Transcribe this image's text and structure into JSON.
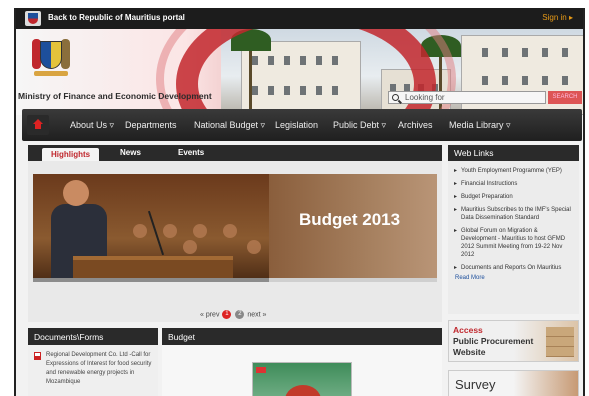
{
  "topbar": {
    "back_label": "Back to Republic of Mauritius portal",
    "signin_label": "Sign in ▸"
  },
  "header": {
    "ministry_name": "Ministry of Finance and Economic Development",
    "search_placeholder": "Looking for",
    "search_button": "SEARCH"
  },
  "nav": {
    "items": [
      {
        "label": "About Us ▿"
      },
      {
        "label": "Departments"
      },
      {
        "label": "National Budget ▿"
      },
      {
        "label": "Legislation"
      },
      {
        "label": "Public Debt ▿"
      },
      {
        "label": "Archives"
      },
      {
        "label": "Media Library ▿"
      }
    ]
  },
  "highlights": {
    "tabs": [
      {
        "label": "Highlights"
      },
      {
        "label": "News"
      },
      {
        "label": "Events"
      }
    ],
    "slide_caption": "Budget 2013",
    "pager": {
      "prev": "« prev",
      "page1": "1",
      "page2": "2",
      "next": "next »"
    }
  },
  "web_links": {
    "title": "Web Links",
    "items": [
      "Youth Employment Programme (YEP)",
      "Financial Instructions",
      "Budget Preparation",
      "Mauritius Subscribes to the IMF's Special Data Dissemination Standard",
      "Global Forum on Migration & Development - Mauritius to host GFMD 2012 Summit Meeting from 19-22 Nov 2012",
      "Documents and Reports On Mauritius"
    ],
    "more": "Read More"
  },
  "documents": {
    "title": "Documents\\Forms",
    "item": "Regional Development Co. Ltd -Call for Expressions of Interest for food security and renewable energy projects in Mozambique"
  },
  "budget": {
    "title": "Budget"
  },
  "procurement": {
    "line1": "Access",
    "line2": "Public Procurement",
    "line3": "Website"
  },
  "survey": {
    "label": "Survey"
  },
  "colors": {
    "brand_red": "#c0272d",
    "nav_dark": "#2a2a2a",
    "signin_orange": "#e79a17"
  }
}
